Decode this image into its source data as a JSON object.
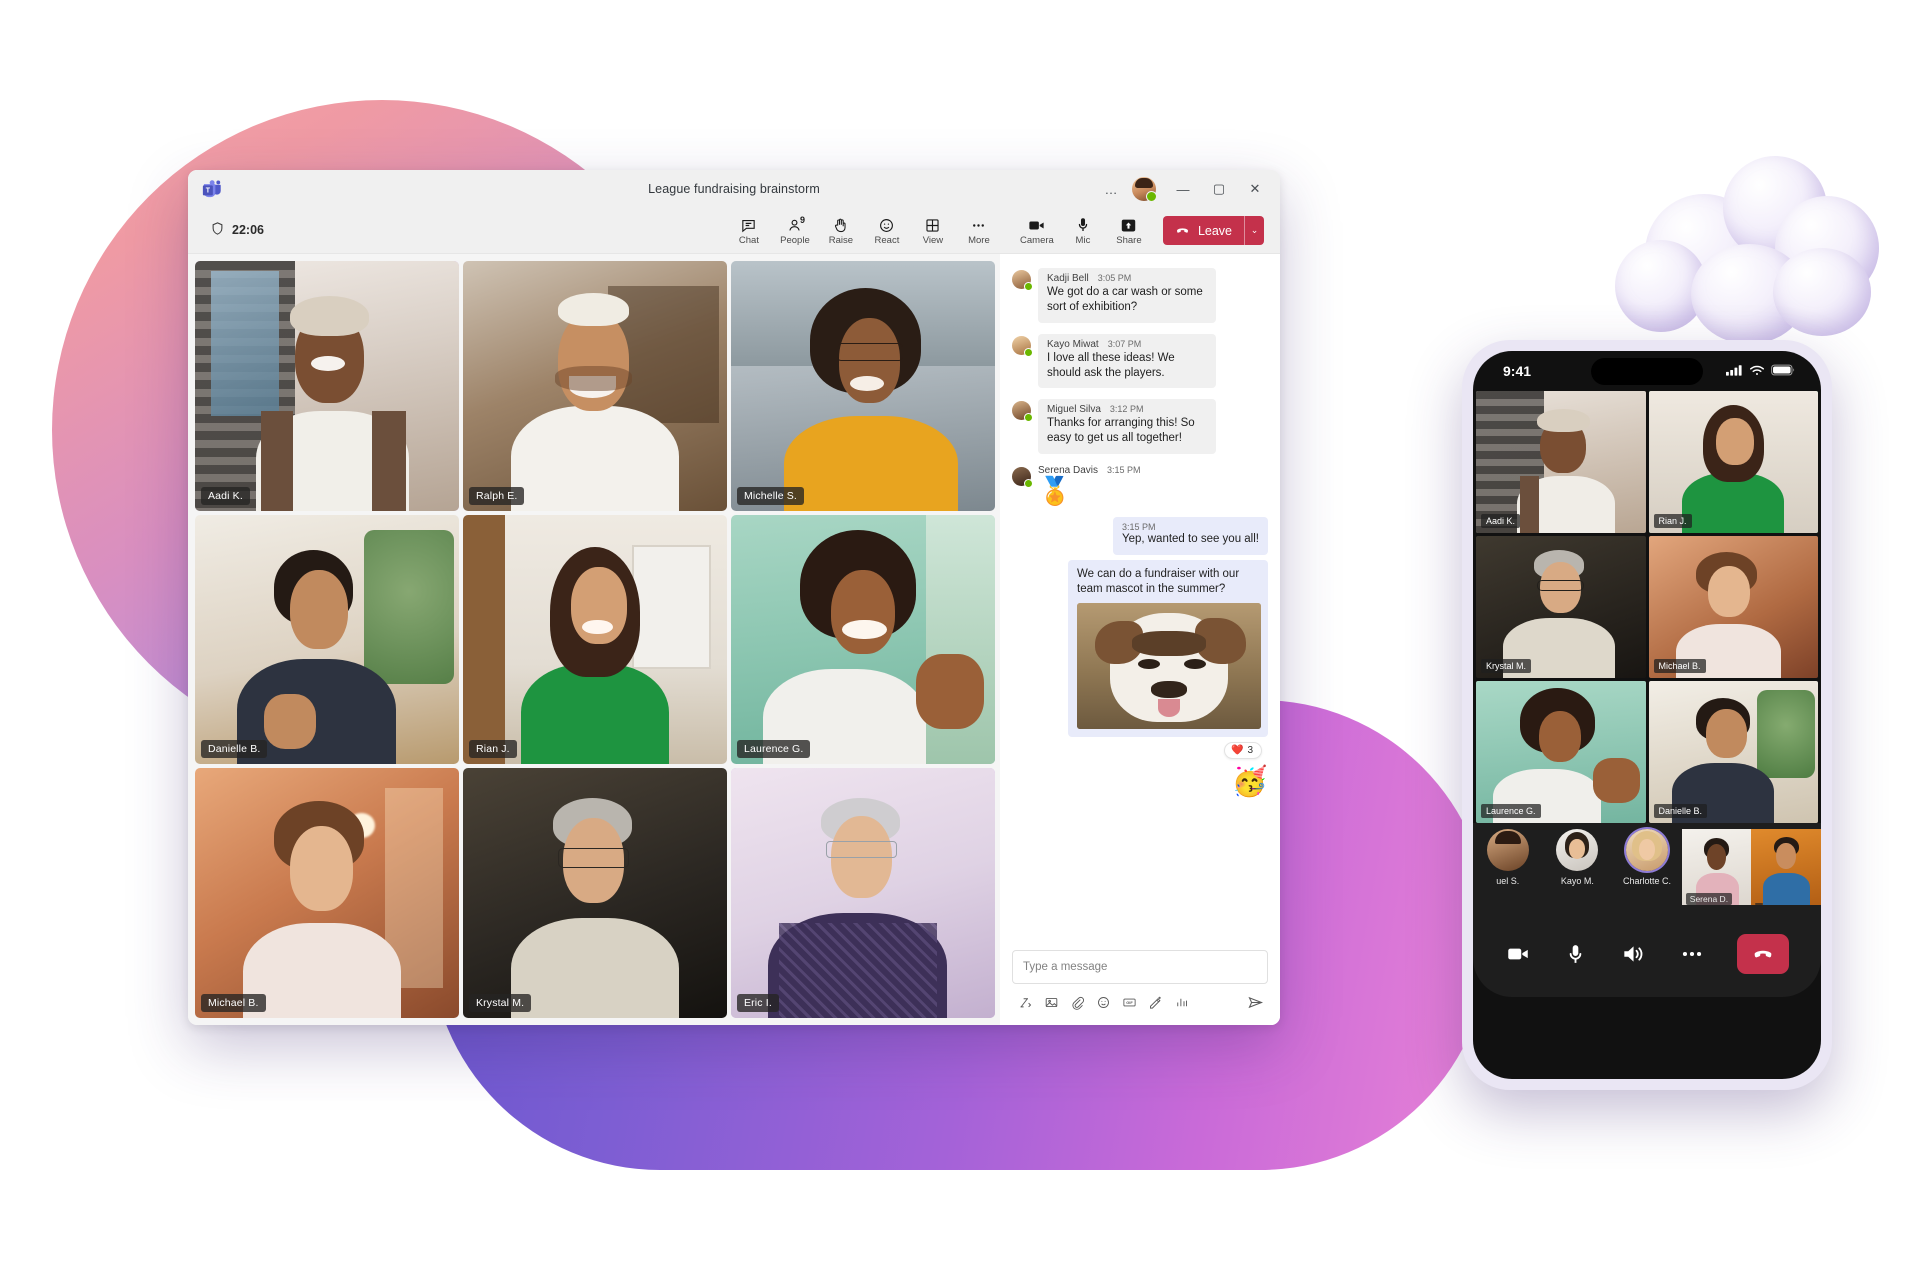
{
  "window": {
    "title": "League fundraising brainstorm",
    "app_logo": "teams-logo",
    "controls": {
      "more": "…",
      "minimize": "—",
      "maximize": "▢",
      "close": "✕"
    }
  },
  "toolbar": {
    "timer": "22:06",
    "shield_icon": "shield-icon",
    "items": [
      {
        "label": "Chat",
        "icon": "chat-icon",
        "badge": ""
      },
      {
        "label": "People",
        "icon": "people-icon",
        "badge": "9"
      },
      {
        "label": "Raise",
        "icon": "hand-icon",
        "badge": ""
      },
      {
        "label": "React",
        "icon": "smiley-icon",
        "badge": ""
      },
      {
        "label": "View",
        "icon": "grid-icon",
        "badge": ""
      },
      {
        "label": "More",
        "icon": "ellipsis-icon",
        "badge": ""
      },
      {
        "label": "Camera",
        "icon": "camera-icon",
        "badge": ""
      },
      {
        "label": "Mic",
        "icon": "mic-icon",
        "badge": ""
      },
      {
        "label": "Share",
        "icon": "share-icon",
        "badge": ""
      }
    ],
    "leave_label": "Leave",
    "leave_caret": "⌄",
    "leave_color": "#c4314b"
  },
  "stage": {
    "tiles": [
      {
        "name": "Aadi K.",
        "speaking": true
      },
      {
        "name": "Ralph E.",
        "speaking": false
      },
      {
        "name": "Michelle S.",
        "speaking": false
      },
      {
        "name": "Danielle B.",
        "speaking": false
      },
      {
        "name": "Rian J.",
        "speaking": false
      },
      {
        "name": "Laurence G.",
        "speaking": false
      },
      {
        "name": "Michael B.",
        "speaking": false
      },
      {
        "name": "Krystal M.",
        "speaking": false
      },
      {
        "name": "Eric I.",
        "speaking": true
      }
    ]
  },
  "chat": {
    "messages": [
      {
        "author": "Kadji Bell",
        "time": "3:05 PM",
        "text": "We got do a car wash or some sort of exhibition?",
        "side": "in"
      },
      {
        "author": "Kayo Miwat",
        "time": "3:07 PM",
        "text": "I love all these ideas! We should ask the players.",
        "side": "in"
      },
      {
        "author": "Miguel Silva",
        "time": "3:12 PM",
        "text": "Thanks for arranging this! So easy to get us all together!",
        "side": "in"
      },
      {
        "author": "Serena Davis",
        "time": "3:15 PM",
        "text": "🏅",
        "side": "in",
        "emoji_only": true
      }
    ],
    "outgoing": [
      {
        "time": "3:15 PM",
        "text": "Yep, wanted to see you all!"
      },
      {
        "time": "",
        "text": "We can do a fundraiser with our team mascot in the summer?",
        "image": "bulldog-photo"
      }
    ],
    "reaction": {
      "icon": "❤️",
      "count": "3"
    },
    "floating_emoji": "🥳",
    "composer": {
      "placeholder": "Type a message",
      "value": "",
      "icons": [
        "format-icon",
        "image-icon",
        "attach-icon",
        "emoji-icon",
        "gif-icon",
        "sticker-icon",
        "poll-icon",
        "send-icon"
      ]
    }
  },
  "phone": {
    "status": {
      "time": "9:41",
      "signal": "signal-icon",
      "wifi": "wifi-icon",
      "battery": "battery-icon"
    },
    "tiles": [
      {
        "name": "Aadi K.",
        "speaking": false
      },
      {
        "name": "Rian J.",
        "speaking": true
      },
      {
        "name": "Krystal M.",
        "speaking": false
      },
      {
        "name": "Michael B.",
        "speaking": false
      },
      {
        "name": "Laurence G.",
        "speaking": false
      },
      {
        "name": "Danielle B.",
        "speaking": false
      }
    ],
    "strip": [
      {
        "name": "uel S.",
        "type": "avatar",
        "ring": false
      },
      {
        "name": "Kayo M.",
        "type": "avatar",
        "ring": false
      },
      {
        "name": "Charlotte C.",
        "type": "avatar",
        "ring": true
      },
      {
        "name": "Serena D.",
        "type": "video",
        "ring": false
      },
      {
        "name": "",
        "type": "video",
        "ring": false
      }
    ],
    "bar": {
      "camera": "camera-icon",
      "mic": "mic-icon",
      "speaker": "speaker-icon",
      "more": "ellipsis-icon",
      "end_call": "end-call-icon",
      "end_call_color": "#c4314b"
    }
  },
  "theme": {
    "accent_purple": "#6264a7",
    "danger_red": "#c4314b",
    "presence_green": "#6bb700",
    "bubble_in": "#f0f0f0",
    "bubble_out": "#e8ebfa"
  }
}
